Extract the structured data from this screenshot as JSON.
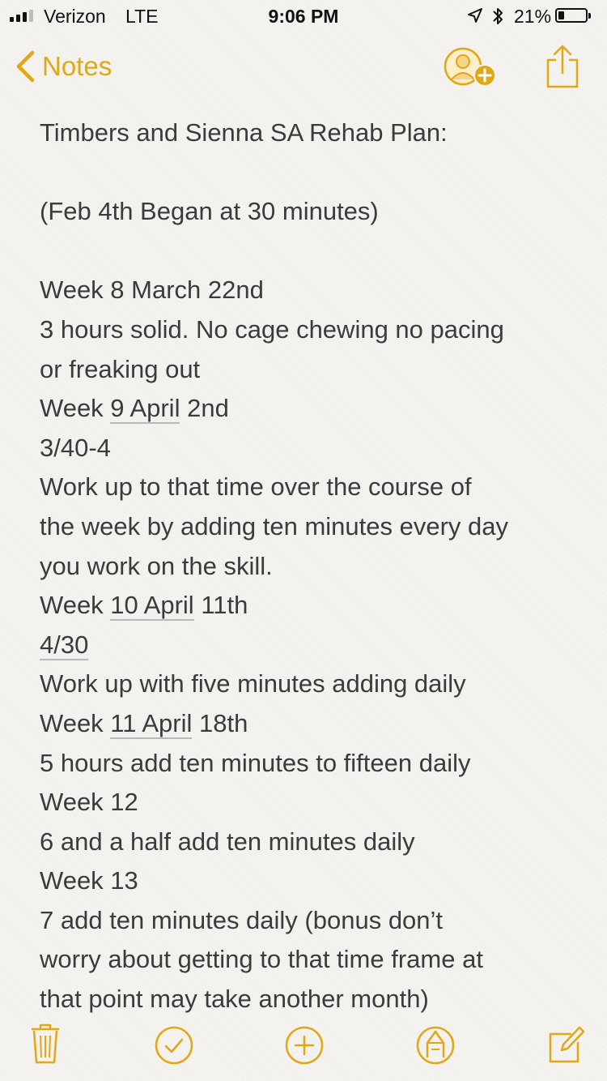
{
  "status_bar": {
    "carrier": "Verizon",
    "network": "LTE",
    "time": "9:06 PM",
    "battery_percent": "21%",
    "battery_level": 0.21
  },
  "nav": {
    "back_label": "Notes"
  },
  "colors": {
    "accent": "#e0a816",
    "text": "#3b3b3b",
    "background": "#f4f3ef"
  },
  "note": {
    "lines": [
      "Timbers and Sienna SA Rehab Plan:",
      "",
      "(Feb 4th Began at 30 minutes)",
      "",
      "Week 8 March 22nd",
      "3 hours solid. No cage chewing no pacing",
      "or freaking out",
      "Week 9 April 2nd",
      "3/40-4",
      "Work up to that time over the course of",
      "the week by adding ten minutes every day",
      "you work on the skill.",
      "Week 10 April 11th",
      "4/30",
      "Work up with five minutes adding daily",
      "Week 11 April 18th",
      "5 hours add ten minutes to fifteen daily",
      "Week 12",
      "6 and a half add ten minutes daily",
      "Week 13",
      "7 add ten minutes daily (bonus don’t",
      "worry about getting to that time frame at",
      "that point may take another month)"
    ]
  },
  "icons": {
    "back": "chevron-left-icon",
    "add_person": "person-add-icon",
    "share": "share-icon",
    "delete": "trash-icon",
    "checklist": "checkmark-circle-icon",
    "add": "plus-circle-icon",
    "markup": "pen-circle-icon",
    "compose": "compose-icon"
  }
}
